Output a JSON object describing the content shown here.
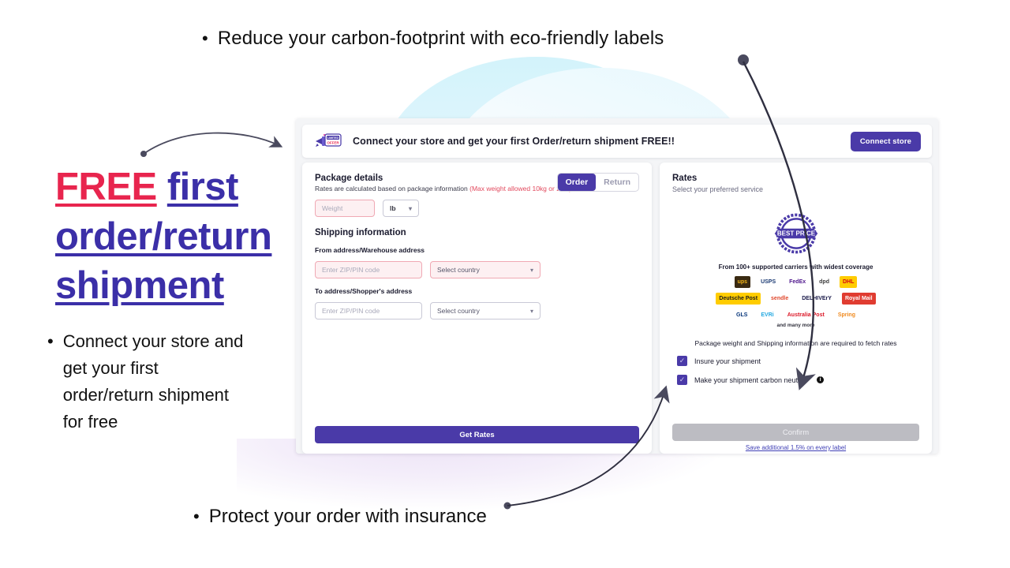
{
  "marketing": {
    "bullet_top": "Reduce your carbon-footprint with eco-friendly labels",
    "bullet_bottom": "Protect your order with insurance",
    "headline_free": "FREE",
    "headline_rest": "first order/return shipment",
    "bullet_left": "Connect your store and get your first order/return shipment for free"
  },
  "app": {
    "banner": {
      "logo_text_line1": "LIMITED",
      "logo_text_line2": "OFFER",
      "message": "Connect your store and get your first Order/return shipment FREE!!",
      "connect_button": "Connect store"
    },
    "package_panel": {
      "title": "Package details",
      "subtitle": "Rates are calculated based on package information",
      "max_weight_note": "(Max weight allowed 10kg or 22lb)",
      "weight_placeholder": "Weight",
      "unit_value": "lb",
      "segmented": {
        "order": "Order",
        "return": "Return",
        "selected": "Order"
      },
      "shipping_title": "Shipping information",
      "from_label": "From address/Warehouse address",
      "from_zip_placeholder": "Enter ZIP/PIN code",
      "from_country_value": "Select country",
      "to_label": "To address/Shopper's address",
      "to_zip_placeholder": "Enter ZIP/PIN code",
      "to_country_value": "Select country",
      "get_rates_button": "Get Rates"
    },
    "rates_panel": {
      "title": "Rates",
      "subtitle": "Select your preferred service",
      "badge_text": "BEST PRICE",
      "carriers_note": "From 100+ supported carriers with widest coverage",
      "carriers": [
        [
          {
            "name": "UPS",
            "label": "ups",
            "bg": "#3a2a12",
            "fg": "#f2b417"
          },
          {
            "name": "USPS",
            "label": "USPS",
            "bg": "#ffffff",
            "fg": "#1b3a73"
          },
          {
            "name": "FedEx",
            "label": "FedEx",
            "bg": "#ffffff",
            "fg": "#4d148c"
          },
          {
            "name": "DPD",
            "label": "dpd",
            "bg": "#ffffff",
            "fg": "#3b3b3b"
          },
          {
            "name": "DHL",
            "label": "DHL",
            "bg": "#ffcc00",
            "fg": "#d40511"
          }
        ],
        [
          {
            "name": "Deutsche Post",
            "label": "Deutsche Post",
            "bg": "#ffcc00",
            "fg": "#1a1a1a"
          },
          {
            "name": "Sendle",
            "label": "sendle",
            "bg": "#ffffff",
            "fg": "#e0472c"
          },
          {
            "name": "Delhivery",
            "label": "DELHIVErY",
            "bg": "#ffffff",
            "fg": "#1a1a4a"
          },
          {
            "name": "Royal Mail",
            "label": "Royal Mail",
            "bg": "#e03c31",
            "fg": "#ffffff"
          }
        ],
        [
          {
            "name": "GLS",
            "label": "GLS",
            "bg": "#ffffff",
            "fg": "#06357a"
          },
          {
            "name": "EVRi",
            "label": "EVRi",
            "bg": "#ffffff",
            "fg": "#24a9e1"
          },
          {
            "name": "Australia Post",
            "label": "Australia Post",
            "bg": "#ffffff",
            "fg": "#dc1928"
          },
          {
            "name": "Spring",
            "label": "Spring",
            "bg": "#ffffff",
            "fg": "#f08a1e"
          }
        ]
      ],
      "and_many_more": "and many more",
      "requirement_note": "Package weight and Shipping information are required to fetch rates",
      "checkbox_insure": "Insure your shipment",
      "checkbox_carbon": "Make your shipment carbon neutral",
      "info_icon_char": "i",
      "confirm_button": "Confirm",
      "save_note": "Save additional 1.5% on every label"
    }
  },
  "colors": {
    "brand_purple": "#4a3aa8",
    "accent_red": "#e8254e",
    "headline_blue": "#3b2fa8",
    "arrow_gray": "#4a4a5e",
    "arc_blue": "#d3f3fb"
  }
}
